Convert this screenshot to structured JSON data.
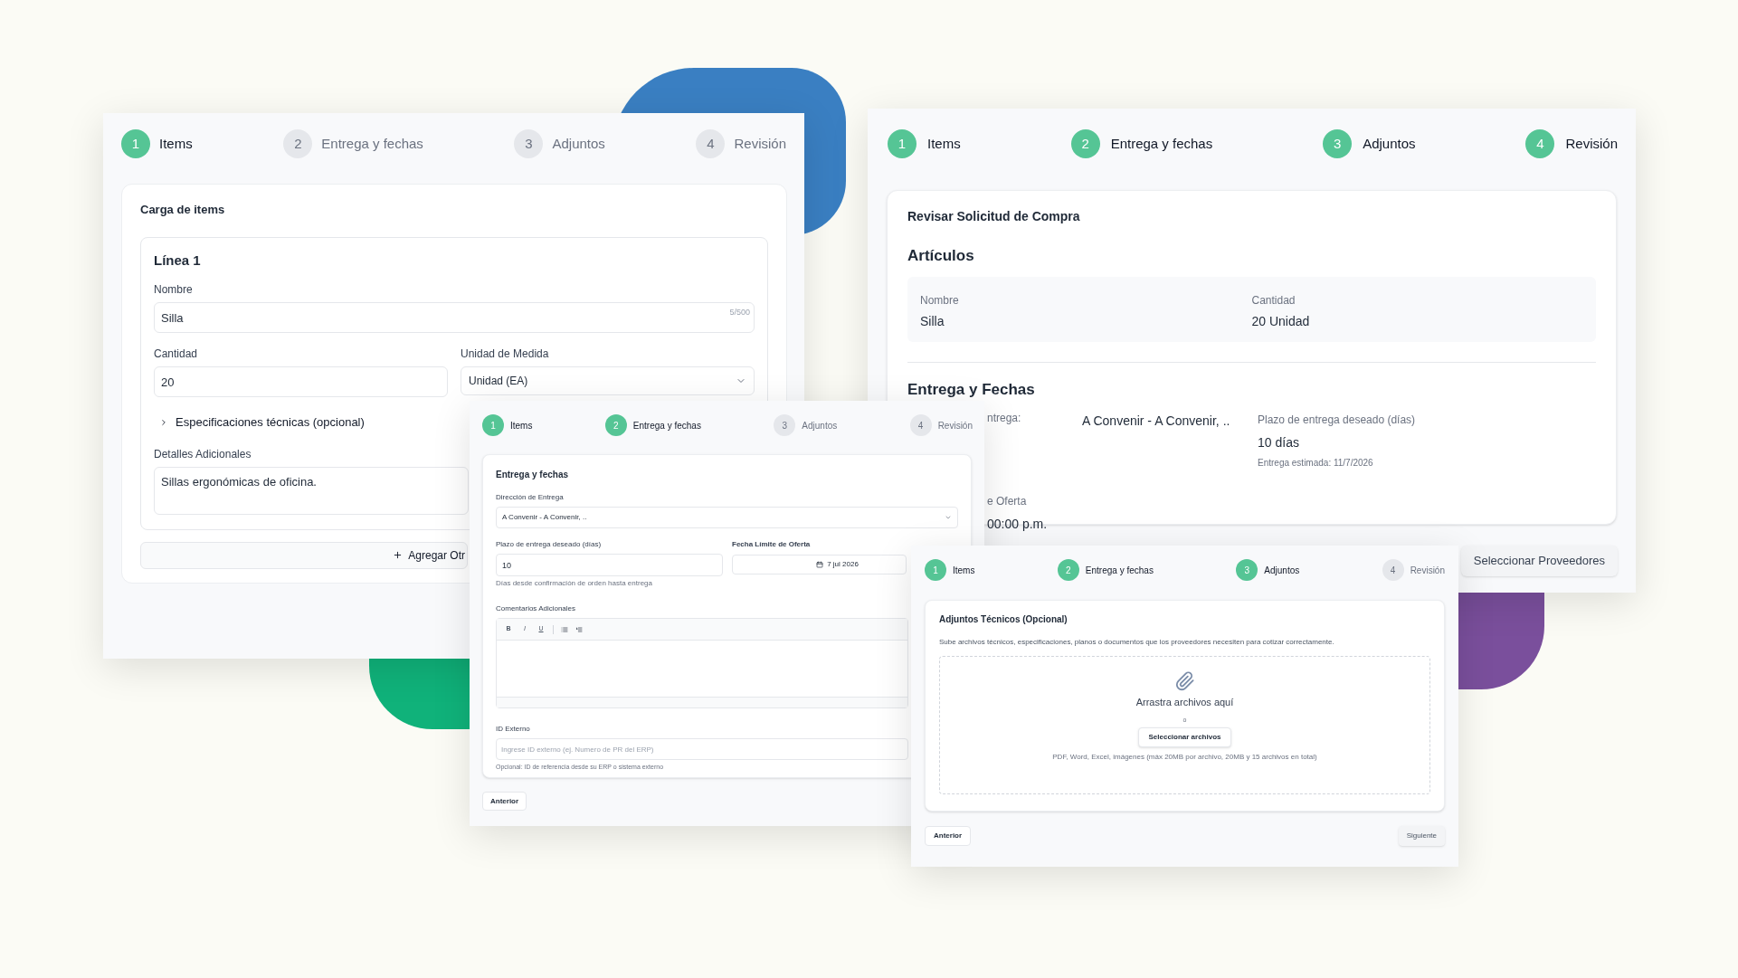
{
  "items_panel": {
    "steps": [
      {
        "number": "1",
        "label": "Items",
        "active": true
      },
      {
        "number": "2",
        "label": "Entrega y fechas",
        "active": false
      },
      {
        "number": "3",
        "label": "Adjuntos",
        "active": false
      },
      {
        "number": "4",
        "label": "Revisión",
        "active": false
      }
    ],
    "title": "Carga de items",
    "line_title": "Línea 1",
    "name_field": {
      "label": "Nombre",
      "value": "Silla",
      "counter": "5/500"
    },
    "quantity_field": {
      "label": "Cantidad",
      "value": "20"
    },
    "unit_field": {
      "label": "Unidad de Medida",
      "value": "Unidad (EA)"
    },
    "specs_toggle": {
      "label": "Especificaciones técnicas (opcional)",
      "expanded": false
    },
    "details_field": {
      "label": "Detalles Adicionales",
      "value": "Sillas ergonómicas de oficina."
    },
    "add_button": "Agregar Otr"
  },
  "review_panel": {
    "steps": [
      {
        "number": "1",
        "label": "Items",
        "active": true
      },
      {
        "number": "2",
        "label": "Entrega y fechas",
        "active": true
      },
      {
        "number": "3",
        "label": "Adjuntos",
        "active": true
      },
      {
        "number": "4",
        "label": "Revisión",
        "active": true
      }
    ],
    "title": "Revisar Solicitud de Compra",
    "items_heading": "Artículos",
    "item_columns": [
      {
        "label": "Nombre",
        "value": "Silla"
      },
      {
        "label": "Cantidad",
        "value": "20 Unidad"
      }
    ],
    "delivery_heading": "Entrega y Fechas",
    "delivery_fields": [
      {
        "kind": "inline",
        "label": "ntrega:",
        "value": "A Convenir - A Convenir, .."
      },
      {
        "kind": "stacked",
        "label": "Plazo de entrega deseado (días)",
        "value": "10 días",
        "note": "Entrega estimada: 11/7/2026"
      },
      {
        "kind": "stacked",
        "label": "e Oferta",
        "value": "00:00 p.m."
      }
    ],
    "button": "Seleccionar Proveedores"
  },
  "delivery_panel": {
    "steps": [
      {
        "number": "1",
        "label": "Items",
        "active": true
      },
      {
        "number": "2",
        "label": "Entrega y fechas",
        "active": true
      },
      {
        "number": "3",
        "label": "Adjuntos",
        "active": false
      },
      {
        "number": "4",
        "label": "Revisión",
        "active": false
      }
    ],
    "title": "Entrega y fechas",
    "address_field": {
      "label": "Dirección de Entrega",
      "value": "A Convenir - A Convenir, .."
    },
    "lead_time_field": {
      "label": "Plazo de entrega deseado (días)",
      "value": "10",
      "help": "Días desde confirmación de orden hasta entrega"
    },
    "deadline_field": {
      "label": "Fecha Límite de Oferta",
      "value": "7 jul 2026"
    },
    "comments_field": {
      "label": "Comentarios Adicionales",
      "toolbar": [
        "B",
        "I",
        "U"
      ]
    },
    "external_id_field": {
      "label": "ID Externo",
      "placeholder": "Ingrese ID externo (ej. Numero de PR del ERP)",
      "help": "Opcional: ID de referencia desde su ERP o sistema externo"
    },
    "back_button": "Anterior"
  },
  "attachments_panel": {
    "steps": [
      {
        "number": "1",
        "label": "Items",
        "active": true
      },
      {
        "number": "2",
        "label": "Entrega y fechas",
        "active": true
      },
      {
        "number": "3",
        "label": "Adjuntos",
        "active": true
      },
      {
        "number": "4",
        "label": "Revisión",
        "active": false
      }
    ],
    "title": "Adjuntos Técnicos (Opcional)",
    "description": "Sube archivos técnicos, especificaciones, planos o documentos que los proveedores necesiten para cotizar correctamente.",
    "dropzone": {
      "title": "Arrastra archivos aquí",
      "separator": "o",
      "button": "Seleccionar archivos",
      "hint": "PDF, Word, Excel, imágenes (máx 20MB por archivo, 20MB y 15 archivos en total)"
    },
    "back_button": "Anterior",
    "next_button": "Siguiente"
  }
}
